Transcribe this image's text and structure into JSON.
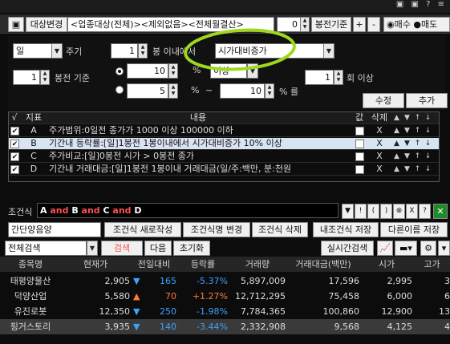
{
  "title_bar": {
    "icons": "▣ ▣ ? ≡"
  },
  "header": {
    "target_change_label": "대상변경",
    "target_value": "<업종대상(전체)><제외없음><전체월결산>",
    "count_value": "0",
    "base_label": "봉전기준",
    "plus_label": "+",
    "minus_label": "-",
    "buy_label": "매수",
    "sell_label": "매도"
  },
  "condition_editor": {
    "period_type": "일",
    "period_label": "주기",
    "within_value": "1",
    "within_label": "봉 이내에서",
    "indicator_select": "시가대비증가",
    "base_value": "1",
    "base_label": "봉전 기준",
    "pct_value1": "10",
    "pct_unit": "%",
    "compare_select": "이상",
    "count_value": "1",
    "count_label": "회 이상",
    "pct_value2": "5",
    "tilde": "~",
    "pct_value3": "10",
    "range_suffix": "% 를",
    "modify_button": "수정",
    "add_button": "추가"
  },
  "condition_table": {
    "headers": [
      "√",
      "지표",
      "내용",
      "값",
      "삭제"
    ],
    "rows": [
      {
        "checked": "✔",
        "id": "A",
        "content": "주가범위:0일전 종가가 1000 이상 100000 이하",
        "delete": "X"
      },
      {
        "checked": "✔",
        "id": "B",
        "content": "기간내 등락률:[일]1봉전 1봉이내에서 시가대비증가 10% 이상",
        "delete": "X"
      },
      {
        "checked": "✔",
        "id": "C",
        "content": "주가비교:[일]0봉전 시가 > 0봉전 종가",
        "delete": "X"
      },
      {
        "checked": "✔",
        "id": "D",
        "content": "기간내 거래대금:[일]1봉전 1봉이내 거래대금(일/주:백만, 분:천원",
        "delete": "X"
      }
    ],
    "arrows": [
      "▲",
      "▼",
      "↑",
      "↓"
    ]
  },
  "condition_expr": {
    "label": "조건식",
    "parts": [
      "A",
      " and ",
      "B",
      " and ",
      "C",
      " and ",
      "D"
    ],
    "tool_buttons": [
      "▼",
      "!",
      "(",
      ")",
      "⊗",
      "X",
      "?"
    ]
  },
  "action_bar": {
    "search_name": "간단양음양",
    "new_button": "조건식 새로작성",
    "rename_button": "조건식명 변경",
    "delete_button": "조건식 삭제",
    "mysave_button": "내조건식 저장",
    "saveas_button": "다른이름 저장"
  },
  "search_bar": {
    "scope_select": "전체검색",
    "search_button": "검색",
    "next_button": "다음",
    "reset_button": "초기화",
    "realtime_button": "실시간검색"
  },
  "results": {
    "headers": [
      "종목명",
      "현재가",
      "전일대비",
      "등락률",
      "거래량",
      "거래대금(백만)",
      "시가",
      "고가"
    ],
    "rows": [
      {
        "name": "태평양물산",
        "price": "2,905",
        "arrow": "▼",
        "change": "165",
        "rate": "-5.37%",
        "volume": "5,897,009",
        "amount": "17,596",
        "open": "2,995",
        "high": "3"
      },
      {
        "name": "덕양산업",
        "price": "5,580",
        "arrow": "▲",
        "change": "70",
        "rate": "+1.27%",
        "volume": "12,712,295",
        "amount": "75,458",
        "open": "6,000",
        "high": "6"
      },
      {
        "name": "유진로봇",
        "price": "12,350",
        "arrow": "▼",
        "change": "250",
        "rate": "-1.98%",
        "volume": "7,784,365",
        "amount": "100,860",
        "open": "12,900",
        "high": "13"
      },
      {
        "name": "핑거스토리",
        "price": "3,935",
        "arrow": "▼",
        "change": "140",
        "rate": "-3.44%",
        "volume": "2,332,908",
        "amount": "9,568",
        "open": "4,125",
        "high": "4"
      }
    ]
  },
  "colors": {
    "accent_red": "#ff5050",
    "down_blue": "#3ea0ff",
    "up_orange": "#ff7a3d",
    "annotation_green": "#9ed81e"
  }
}
